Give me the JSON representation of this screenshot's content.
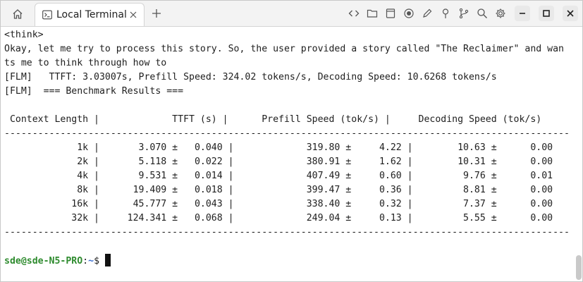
{
  "titlebar": {
    "tab_title": "Local Terminal",
    "toolbar_icons": [
      "code-icon",
      "folder-icon",
      "file-icon",
      "record-icon",
      "pen-icon",
      "pin-icon",
      "branch-icon",
      "search-icon",
      "gear-icon"
    ],
    "window_icons": [
      "minimize-icon",
      "maximize-icon",
      "close-icon"
    ]
  },
  "terminal": {
    "lines": [
      "<think>",
      "Okay, let me try to process this story. So, the user provided a story called \"The Reclaimer\" and wan",
      "ts me to think through how to",
      "[FLM]   TTFT: 3.03007s, Prefill Speed: 324.02 tokens/s, Decoding Speed: 10.6268 tokens/s",
      "[FLM]  === Benchmark Results ===",
      "",
      " Context Length |             TTFT (s) |      Prefill Speed (tok/s) |     Decoding Speed (tok/s)",
      "-----------------------------------------------------------------------------------------------------",
      "             1k |       3.070 ±   0.040 |             319.80 ±     4.22 |        10.63 ±      0.00",
      "             2k |       5.118 ±   0.022 |             380.91 ±     1.62 |        10.31 ±      0.00",
      "             4k |       9.531 ±   0.014 |             407.49 ±     0.60 |         9.76 ±      0.01",
      "             8k |      19.409 ±   0.018 |             399.47 ±     0.36 |         8.81 ±      0.00",
      "            16k |      45.777 ±   0.043 |             338.40 ±     0.32 |         7.37 ±      0.00",
      "            32k |     124.341 ±   0.068 |             249.04 ±     0.13 |         5.55 ±      0.00",
      "-----------------------------------------------------------------------------------------------------",
      ""
    ],
    "prompt_user": "sde@sde-N5-PRO",
    "prompt_sep": ":",
    "prompt_path": "~",
    "prompt_symbol": "$ "
  },
  "colors": {
    "prompt_user": "#2e8b2e",
    "prompt_path": "#3b6fd1",
    "text": "#1e1e1e"
  }
}
